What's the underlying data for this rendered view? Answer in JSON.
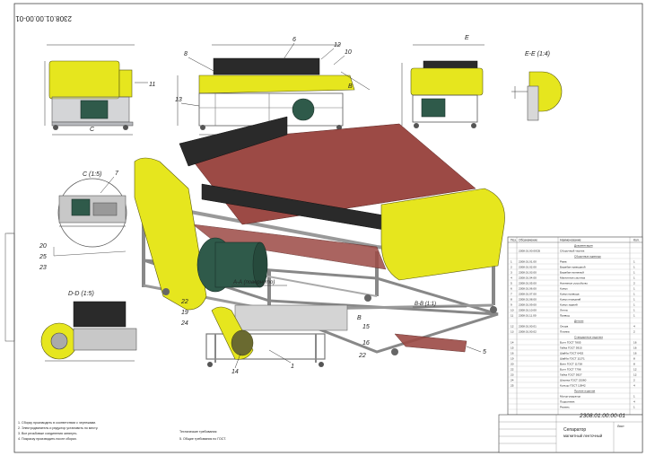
{
  "drawing_number": "2308.01.00.00-01",
  "drawing_number_rotated": "2308.01.00.00-01",
  "section_views": [
    {
      "id": "ee",
      "label": "E-E (1:4)"
    },
    {
      "id": "cc",
      "label": "C (1:5)"
    },
    {
      "id": "dd",
      "label": "D-D (1:5)"
    },
    {
      "id": "aa",
      "label": "A-A (повернуто)"
    },
    {
      "id": "bb",
      "label": "B-B (1:1)"
    }
  ],
  "letters": {
    "c": "C",
    "b": "B",
    "e": "E",
    "a": "A"
  },
  "callouts": [
    "6",
    "8",
    "12",
    "10",
    "11",
    "13",
    "7",
    "20",
    "25",
    "23",
    "22",
    "19",
    "24",
    "1",
    "14",
    "15",
    "16",
    "22",
    "5"
  ],
  "title_block": {
    "name_line1": "Сепаратор",
    "name_line2": "магнитный ленточный",
    "sheet_label": "Лист"
  },
  "notes": [
    "1. Сборку производить в соответствии с чертежами.",
    "2. Электродвигатель и редуктор установить по месту.",
    "3. Все резьбовые соединения затянуть.",
    "4. Покраску производить после сборки."
  ],
  "notes_right": [
    "Технические требования",
    "5. Общие требования по ГОСТ."
  ],
  "spec": {
    "header": [
      "Поз.",
      "Обозначение",
      "Наименование",
      "Кол."
    ],
    "rows": [
      [
        "",
        "",
        "Документация",
        ""
      ],
      [
        "",
        "2308.01.00.00СБ",
        "Сборочный чертеж",
        ""
      ],
      [
        "",
        "",
        "Сборочные единицы",
        ""
      ],
      [
        "1",
        "2308.01.01.00",
        "Рама",
        "1"
      ],
      [
        "2",
        "2308.01.02.00",
        "Барабан приводной",
        "1"
      ],
      [
        "3",
        "2308.01.03.00",
        "Барабан натяжной",
        "1"
      ],
      [
        "4",
        "2308.01.04.00",
        "Магнитная система",
        "1"
      ],
      [
        "5",
        "2308.01.05.00",
        "Натяжное устройство",
        "2"
      ],
      [
        "6",
        "2308.01.06.00",
        "Кожух",
        "1"
      ],
      [
        "7",
        "2308.01.07.00",
        "Кожух привода",
        "1"
      ],
      [
        "8",
        "2308.01.08.00",
        "Кожух передний",
        "1"
      ],
      [
        "9",
        "2308.01.09.00",
        "Кожух задний",
        "1"
      ],
      [
        "10",
        "2308.01.10.00",
        "Лента",
        "1"
      ],
      [
        "11",
        "2308.01.11.00",
        "Привод",
        "1"
      ],
      [
        "",
        "",
        "Детали",
        ""
      ],
      [
        "12",
        "2308.01.00.01",
        "Опора",
        "4"
      ],
      [
        "13",
        "2308.01.00.02",
        "Планка",
        "2"
      ],
      [
        "",
        "",
        "Стандартные изделия",
        ""
      ],
      [
        "14",
        "",
        "Болт ГОСТ 7805",
        "16"
      ],
      [
        "15",
        "",
        "Гайка ГОСТ 5915",
        "16"
      ],
      [
        "16",
        "",
        "Шайба ГОСТ 6402",
        "16"
      ],
      [
        "19",
        "",
        "Шайба ГОСТ 11371",
        "8"
      ],
      [
        "20",
        "",
        "Винт ГОСТ 11738",
        "8"
      ],
      [
        "22",
        "",
        "Болт ГОСТ 7798",
        "12"
      ],
      [
        "23",
        "",
        "Гайка ГОСТ 5927",
        "12"
      ],
      [
        "24",
        "",
        "Шпонка ГОСТ 23360",
        "2"
      ],
      [
        "25",
        "",
        "Кольцо ГОСТ 13942",
        "4"
      ],
      [
        "",
        "",
        "Прочие изделия",
        ""
      ],
      [
        "",
        "",
        "Мотор-редуктор",
        "1"
      ],
      [
        "",
        "",
        "Подшипник",
        "4"
      ],
      [
        "",
        "",
        "Ремень",
        "1"
      ]
    ]
  }
}
